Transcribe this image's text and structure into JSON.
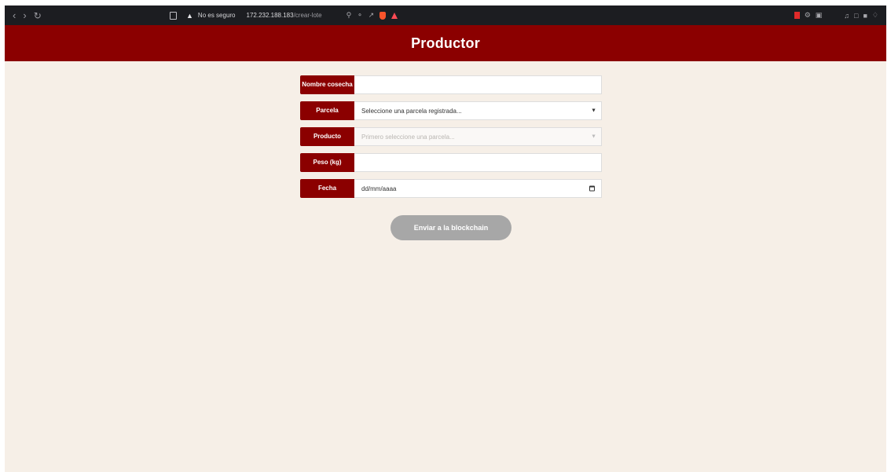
{
  "browser": {
    "insecure_label": "No es seguro",
    "url_host": "172.232.188.183",
    "url_path": "/crear-lote",
    "icons": [
      "back-icon",
      "forward-icon",
      "reload-icon",
      "bookmark-icon",
      "warning-icon",
      "zoom-icon",
      "key-icon",
      "share-icon",
      "brave-shields-icon",
      "brave-rewards-icon",
      "extensions-icon"
    ]
  },
  "header": {
    "title": "Productor",
    "color": "#8b0000"
  },
  "form": {
    "fields": [
      {
        "label": "Nombre cosecha",
        "value": "",
        "type": "text"
      },
      {
        "label": "Parcela",
        "value": "Seleccione una parcela registrada...",
        "type": "select"
      },
      {
        "label": "Producto",
        "value": "Primero seleccione una parcela...",
        "type": "select",
        "disabled": true
      },
      {
        "label": "Peso (kg)",
        "value": "",
        "type": "text"
      },
      {
        "label": "Fecha",
        "value": "dd/mm/aaaa",
        "type": "date"
      }
    ],
    "submit_label": "Enviar a la blockchain"
  },
  "colors": {
    "accent": "#8b0000",
    "background": "#f6efe7",
    "button_disabled": "#a7a7a7"
  }
}
